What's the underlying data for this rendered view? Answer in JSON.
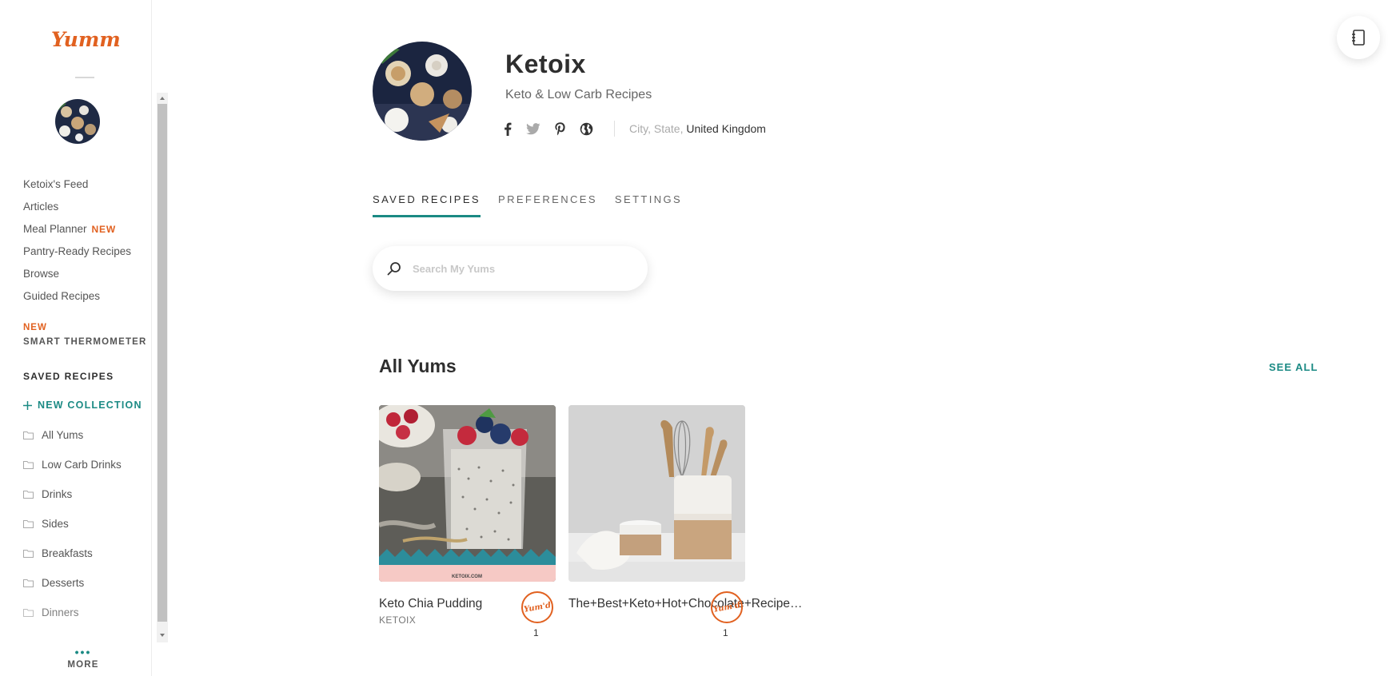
{
  "brand": {
    "logo_text": "Yummly",
    "accent_color": "#e16120",
    "teal_color": "#1b8a84"
  },
  "sidebar": {
    "nav": [
      {
        "label": "Ketoix's Feed"
      },
      {
        "label": "Articles"
      },
      {
        "label": "Meal Planner",
        "badge": "NEW"
      },
      {
        "label": "Pantry-Ready Recipes"
      },
      {
        "label": "Browse"
      },
      {
        "label": "Guided Recipes"
      }
    ],
    "promo": {
      "badge": "NEW",
      "label": "SMART THERMOMETER"
    },
    "saved_header": "SAVED RECIPES",
    "new_collection": "NEW COLLECTION",
    "collections": [
      "All Yums",
      "Low Carb Drinks",
      "Drinks",
      "Sides",
      "Breakfasts",
      "Desserts",
      "Dinners"
    ],
    "more_label": "MORE"
  },
  "profile": {
    "name": "Ketoix",
    "subtitle": "Keto & Low Carb Recipes",
    "location": {
      "city": "City",
      "state": "State",
      "country": "United Kingdom"
    },
    "socials": [
      "facebook-icon",
      "twitter-icon",
      "pinterest-icon",
      "globe-icon"
    ]
  },
  "tabs": [
    {
      "label": "SAVED RECIPES",
      "active": true
    },
    {
      "label": "PREFERENCES",
      "active": false
    },
    {
      "label": "SETTINGS",
      "active": false
    }
  ],
  "search": {
    "placeholder": "Search My Yums",
    "value": ""
  },
  "section": {
    "title": "All Yums",
    "see_all": "SEE ALL"
  },
  "recipes": [
    {
      "title": "Keto Chia Pudding",
      "author": "KETOIX",
      "yum_label": "Yum'd",
      "yum_count": "1",
      "watermark": "KETOIX.COM"
    },
    {
      "title": "The+Best+Keto+Hot+Chocolate+Recipe…",
      "author": "",
      "yum_label": "Yum'd",
      "yum_count": "1"
    }
  ]
}
